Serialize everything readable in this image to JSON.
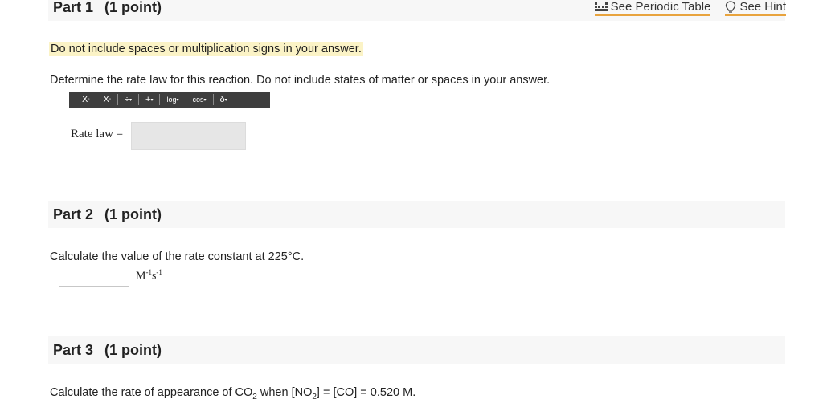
{
  "part1": {
    "title": "Part 1",
    "points": "(1 point)"
  },
  "links": {
    "periodic_table": "See Periodic Table",
    "hint": "See Hint"
  },
  "instructions": {
    "no_spaces": "Do not include spaces or multiplication signs in your answer."
  },
  "question1": "Determine the rate law for this reaction. Do not include states of matter or spaces in your answer.",
  "toolbar": {
    "superscript": "X",
    "subscript": "X",
    "fraction": "÷",
    "plus": "+",
    "log": "log",
    "cos": "cos",
    "delta": "δ"
  },
  "rate_law_label": "Rate law =",
  "part2": {
    "title": "Part 2",
    "points": "(1 point)"
  },
  "question2": "Calculate the value of the rate constant at 225°C.",
  "units": {
    "m": "M",
    "m_exp": "-1",
    "s": "s",
    "s_exp": "-1"
  },
  "part3": {
    "title": "Part 3",
    "points": "(1 point)"
  },
  "question3": {
    "prefix": "Calculate the rate of appearance of CO",
    "sub1": "2",
    "middle": " when [NO",
    "sub2": "2",
    "suffix": "] = [CO] = 0.520 M."
  },
  "colors": {
    "highlight": "#fbf3c6",
    "link_underline": "#e8a33d",
    "toolbar": "#3e3e3e",
    "header_bg": "#f7f7f7"
  },
  "icons": [
    "periodic-table-icon",
    "lightbulb-icon"
  ]
}
